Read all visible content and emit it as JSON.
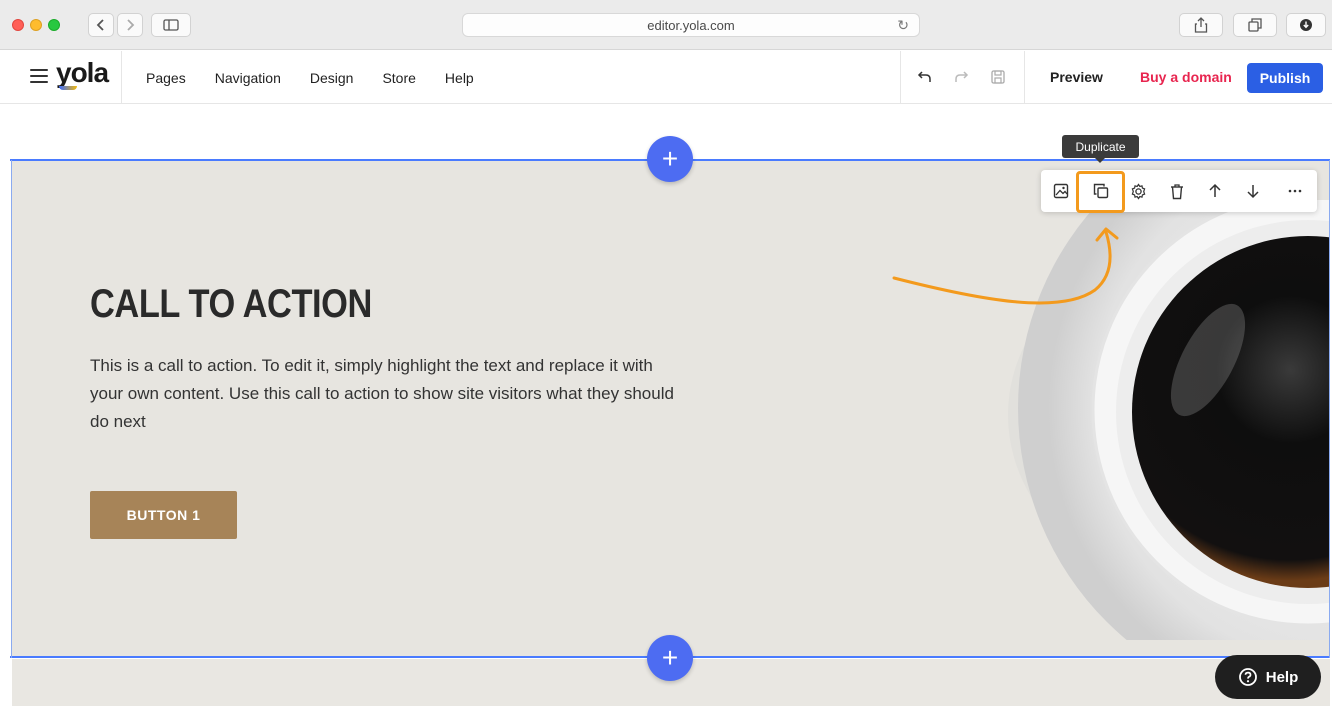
{
  "browser": {
    "url": "editor.yola.com"
  },
  "editor": {
    "logo": "yola",
    "nav": [
      "Pages",
      "Navigation",
      "Design",
      "Store",
      "Help"
    ],
    "preview_label": "Preview",
    "buy_domain_label": "Buy a domain",
    "publish_label": "Publish"
  },
  "section": {
    "title": "CALL TO ACTION",
    "text": "This is a call to action. To edit it, simply highlight the text and replace it with your own content. Use this call to action to show site visitors what they should do next",
    "button_label": "BUTTON 1"
  },
  "toolbar": {
    "tooltip": "Duplicate",
    "icons": [
      "image-icon",
      "duplicate-icon",
      "settings-icon",
      "delete-icon",
      "arrow-up-icon",
      "arrow-down-icon",
      "more-icon"
    ]
  },
  "add_section_symbol": "+",
  "help_label": "Help",
  "colors": {
    "accent": "#4d6cf2",
    "publish": "#2b5fe4",
    "buy_domain": "#e8254f",
    "highlight": "#f39a1d",
    "hero_button": "#a78458"
  }
}
